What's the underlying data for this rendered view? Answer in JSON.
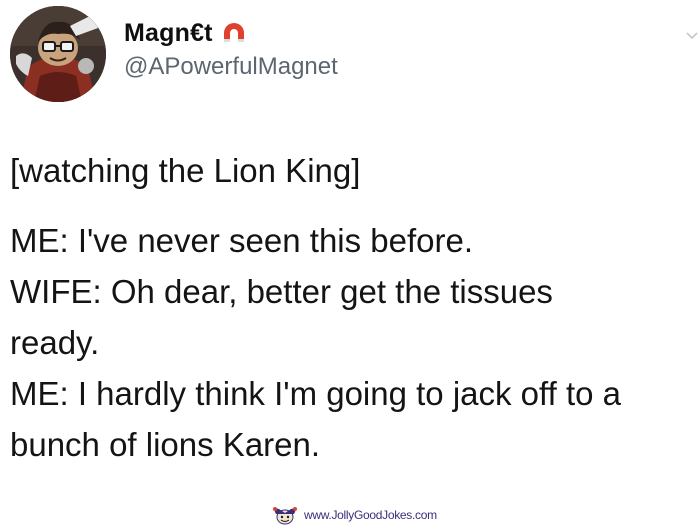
{
  "author": {
    "display_name": "Magn€t",
    "handle": "@APowerfulMagnet",
    "avatar_icon": "cartoon-character-avatar",
    "badge_icon": "magnet-icon",
    "badge_color": "#e0412f"
  },
  "tweet": {
    "lines": [
      "[watching the Lion King]",
      "ME: I've never seen this before.",
      "WIFE: Oh dear, better get the tissues",
      "ready.",
      "ME: I hardly think I'm going to jack off to a",
      "bunch of lions Karen."
    ]
  },
  "watermark": {
    "text": "www.JollyGoodJokes.com",
    "logo_icon": "jester-logo-icon",
    "color": "#3a2f7a"
  }
}
